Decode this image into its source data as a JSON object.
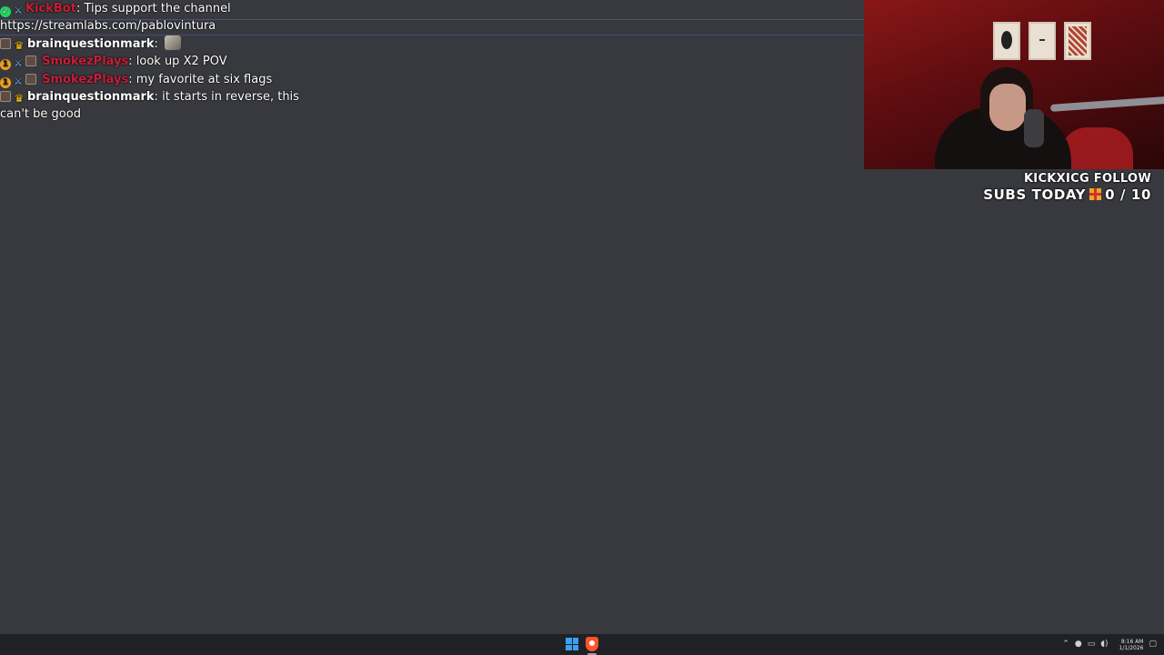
{
  "chat": {
    "messages": [
      {
        "badges": [
          "green-check",
          "sword"
        ],
        "username": "KickBot",
        "username_color": "#c61f3a",
        "text": "Tips support the channel https://streamlabs.com/pablovintura"
      },
      {
        "badges": [
          "avatar",
          "crown"
        ],
        "username": "brainquestionmark",
        "username_color": "#ffffff",
        "text": "",
        "emote": "emote-icon"
      },
      {
        "badges": [
          "one-month",
          "sword",
          "avatar"
        ],
        "username": "SmokezPlays",
        "username_color": "#c61f3a",
        "text": "look up X2 POV"
      },
      {
        "badges": [
          "one-month",
          "sword",
          "avatar"
        ],
        "username": "SmokezPlays",
        "username_color": "#c61f3a",
        "text": "my favorite at six flags"
      },
      {
        "badges": [
          "avatar",
          "crown"
        ],
        "username": "brainquestionmark",
        "username_color": "#ffffff",
        "text": "it starts in reverse, this can't be good"
      }
    ],
    "separator": ":"
  },
  "goal": {
    "line1": "KICKXICG FOLLOW",
    "line2_prefix": "SUBS TODAY",
    "line2_count": "0 / 10",
    "gift_icon": "gift-icon"
  },
  "webcam": {
    "label": "streamer-webcam"
  },
  "taskbar": {
    "clock_time": "8:16 AM",
    "clock_date": "1/1/2026",
    "icons": [
      "windows-start-icon",
      "brave-browser-icon"
    ],
    "tray_icons": [
      "chevron-up-icon",
      "mic-icon",
      "network-icon",
      "volume-icon",
      "notification-icon"
    ]
  },
  "colors": {
    "background": "#38393e",
    "taskbar": "#202124",
    "accent_red": "#c61f3a"
  }
}
